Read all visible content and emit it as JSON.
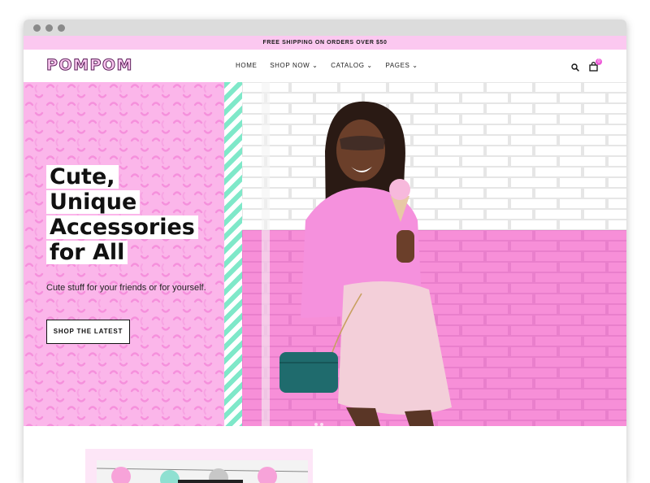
{
  "announcement": "FREE SHIPPING ON ORDERS OVER $50",
  "brand": {
    "logo": "POMPOM"
  },
  "nav": {
    "items": [
      {
        "label": "HOME"
      },
      {
        "label": "SHOP NOW ⌄"
      },
      {
        "label": "CATALOG ⌄"
      },
      {
        "label": "PAGES ⌄"
      }
    ]
  },
  "header_icons": {
    "search": "search-icon",
    "cart": "cart-icon",
    "cart_count": "0"
  },
  "hero": {
    "title_lines": [
      "Cute,",
      "Unique",
      "Accessories",
      "for All"
    ],
    "subtitle": "Cute stuff for your friends or for yourself.",
    "cta": "SHOP THE LATEST"
  },
  "colors": {
    "brand_pink": "#fbc8f0",
    "hero_pink": "#fbb6ea",
    "mint": "#7fe8c9",
    "brick_pink": "#f68bd6",
    "logo_outline": "#5b1e5a"
  }
}
